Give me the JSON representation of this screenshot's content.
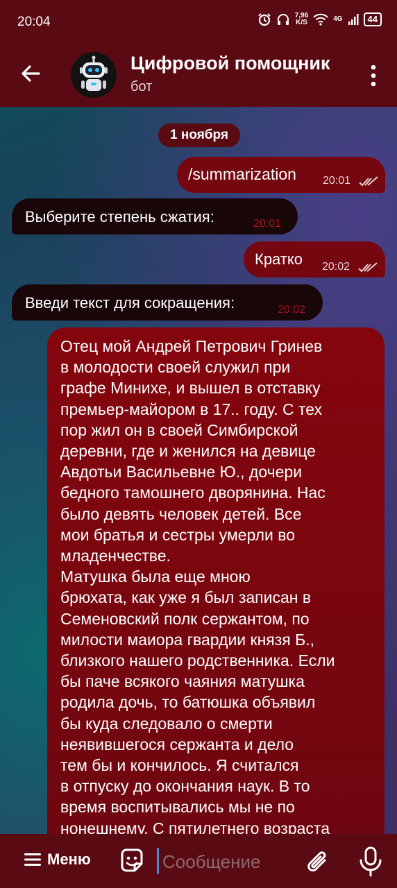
{
  "status_bar": {
    "time": "20:04",
    "net_speed_value": "7,96",
    "net_speed_unit": "K/S",
    "network": "4G",
    "battery": "44",
    "icons": [
      "alarm-icon",
      "headphones-icon",
      "wifi-icon",
      "signal-icon",
      "battery-icon"
    ]
  },
  "header": {
    "title": "Цифровой помощник",
    "subtitle": "бот",
    "back_icon": "arrow-left-icon",
    "more_icon": "more-vertical-icon",
    "avatar_icon": "robot-icon"
  },
  "chat": {
    "date_label": "1 ноября",
    "messages": [
      {
        "direction": "out",
        "text": "/summarization",
        "time": "20:01",
        "status": "read"
      },
      {
        "direction": "in",
        "text": "Выберите степень сжатия:",
        "time": "20:01"
      },
      {
        "direction": "out",
        "text": "Кратко",
        "time": "20:02",
        "status": "read"
      },
      {
        "direction": "in",
        "text": "Введи текст для сокращения:",
        "time": "20:02"
      },
      {
        "direction": "out",
        "text": "Отец мой Андрей Петрович Гринев\nв молодости своей служил при\nграфе Минихе, и вышел в отставку\nпремьер-майором в 17.. году. С тех\nпор жил он в своей Симбирской\nдеревни, где и женился на девице\nАвдотьи Васильевне Ю., дочери\nбедного тамошнего дворянина. Нас\nбыло девять человек детей. Все\nмои братья и сестры умерли во\nмладенчестве.\nМатушка была еще мною\nбрюхата, как уже я был записан в\nСеменовский полк сержантом, по\nмилости маиора гвардии князя Б.,\nблизкого нашего родственника. Если\nбы паче всякого чаяния матушка\nродила дочь, то батюшка объявил\nбы куда следовало о смерти\nнеявившегося сержанта и дело\nтем бы и кончилось. Я считался\nв отпуску до окончания наук. В то\nвремя воспитывались мы не по\nнонешнему. С пятилетнего возраста"
      }
    ]
  },
  "input_bar": {
    "menu_label": "Меню",
    "placeholder": "Сообщение",
    "icons": [
      "menu-icon",
      "sticker-icon",
      "attach-icon",
      "microphone-icon"
    ]
  },
  "colors": {
    "bar_background": "#5a0a12",
    "outgoing_bubble": "#74070f",
    "incoming_bubble": "#180608",
    "incoming_time": "#a4141f"
  }
}
